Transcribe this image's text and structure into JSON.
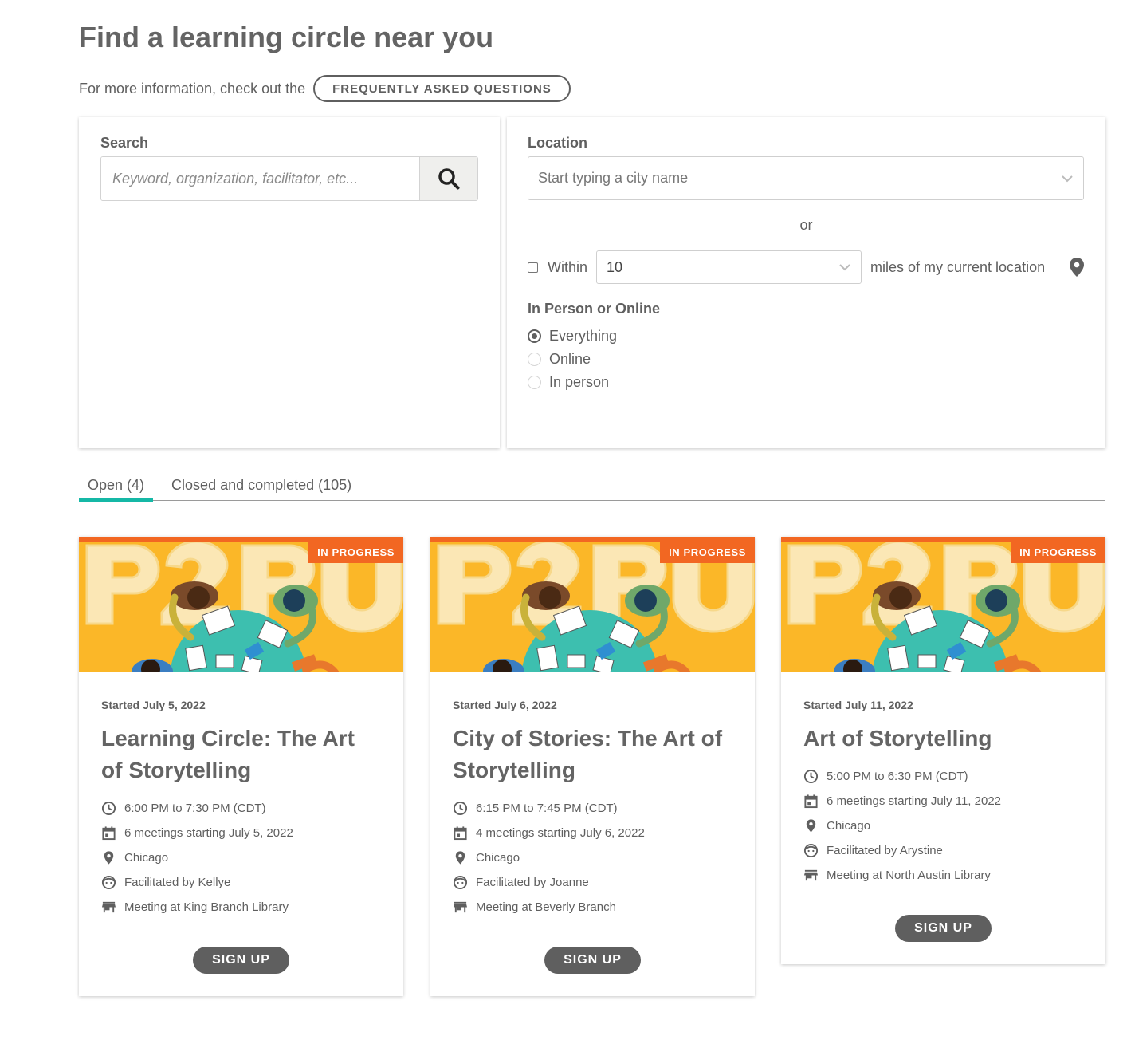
{
  "header": {
    "title": "Find a learning circle near you",
    "info_text": "For more information, check out the",
    "faq_label": "FREQUENTLY ASKED QUESTIONS"
  },
  "search": {
    "label": "Search",
    "placeholder": "Keyword, organization, facilitator, etc..."
  },
  "location": {
    "label": "Location",
    "city_placeholder": "Start typing a city name",
    "or_text": "or",
    "within_label": "Within",
    "miles_value": "10",
    "miles_suffix": "miles of my current location"
  },
  "mode": {
    "label": "In Person or Online",
    "options": [
      "Everything",
      "Online",
      "In person"
    ],
    "selected": "Everything"
  },
  "tabs": [
    {
      "label": "Open (4)",
      "active": true
    },
    {
      "label": "Closed and completed (105)",
      "active": false
    }
  ],
  "cards": [
    {
      "badge": "IN PROGRESS",
      "started": "Started July 5, 2022",
      "title": "Learning Circle: The Art of Storytelling",
      "time": "6:00 PM to 7:30 PM (CDT)",
      "meetings": "6 meetings starting July 5, 2022",
      "city": "Chicago",
      "facilitator": "Facilitated by Kellye",
      "venue": "Meeting at King Branch Library",
      "signup": "SIGN UP"
    },
    {
      "badge": "IN PROGRESS",
      "started": "Started July 6, 2022",
      "title": "City of Stories: The Art of Storytelling",
      "time": "6:15 PM to 7:45 PM (CDT)",
      "meetings": "4 meetings starting July 6, 2022",
      "city": "Chicago",
      "facilitator": "Facilitated by Joanne",
      "venue": "Meeting at Beverly Branch",
      "signup": "SIGN UP"
    },
    {
      "badge": "IN PROGRESS",
      "started": "Started July 11, 2022",
      "title": "Art of Storytelling",
      "time": "5:00 PM to 6:30 PM (CDT)",
      "meetings": "6 meetings starting July 11, 2022",
      "city": "Chicago",
      "facilitator": "Facilitated by Arystine",
      "venue": "Meeting at North Austin Library",
      "signup": "SIGN UP"
    }
  ],
  "banner": {
    "lettering": "P2PU"
  },
  "colors": {
    "accent_teal": "#15b8a6",
    "banner_yellow": "#fbb728",
    "badge_orange": "#f26722",
    "text_gray": "#5f5f5f"
  }
}
